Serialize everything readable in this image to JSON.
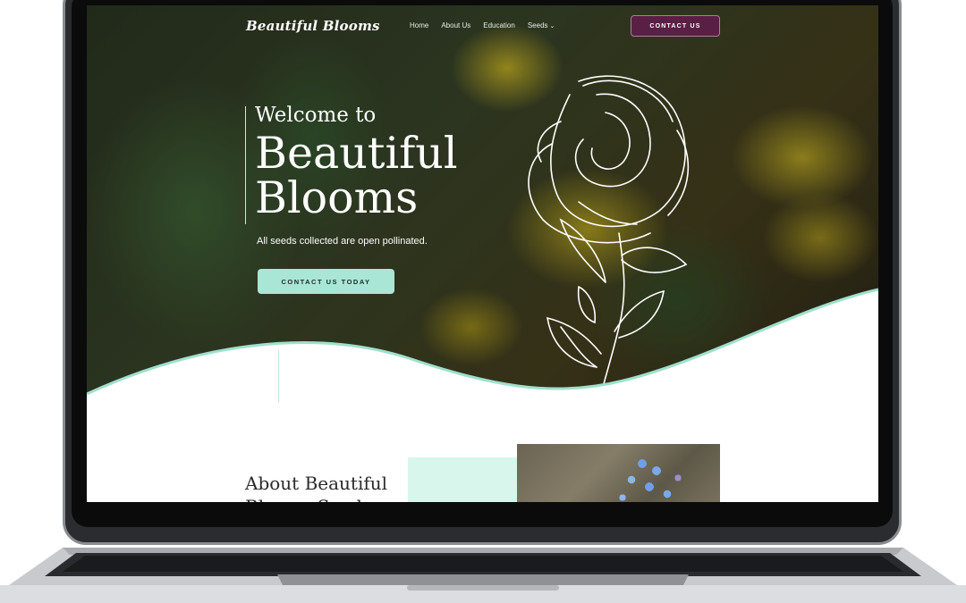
{
  "site": {
    "logo_text": "Beautiful Blooms"
  },
  "nav": {
    "items": [
      {
        "label": "Home"
      },
      {
        "label": "About Us"
      },
      {
        "label": "Education"
      },
      {
        "label": "Seeds"
      }
    ],
    "contact_label": "CONTACT US"
  },
  "hero": {
    "welcome": "Welcome to",
    "title_line1": "Beautiful",
    "title_line2": "Blooms",
    "tagline": "All seeds collected are open pollinated.",
    "cta_label": "CONTACT US TODAY"
  },
  "about": {
    "heading_line1": "About Beautiful",
    "heading_line2": "Blooms Seeds"
  },
  "colors": {
    "accent_mint": "#a9e6d5",
    "accent_plum": "#5a1f45",
    "wave_stroke": "#9fe0cd"
  },
  "icons": {
    "seeds_dropdown": "chevron-down-icon",
    "hero_art": "rose-outline-icon"
  }
}
